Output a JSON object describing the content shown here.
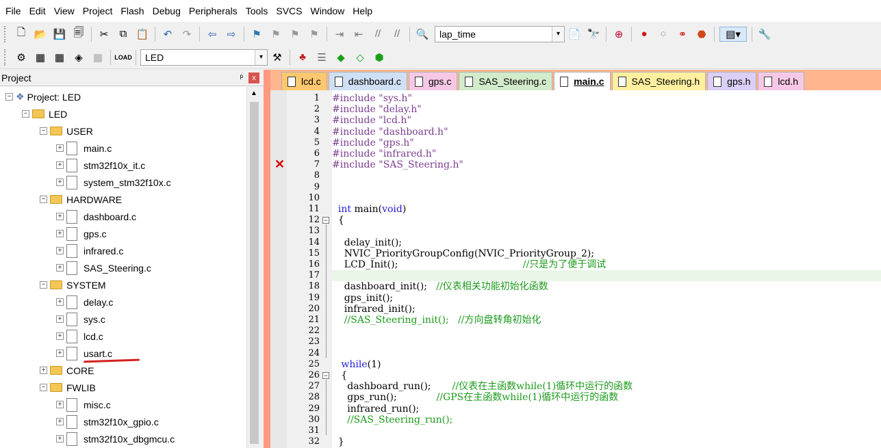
{
  "menu": [
    "File",
    "Edit",
    "View",
    "Project",
    "Flash",
    "Debug",
    "Peripherals",
    "Tools",
    "SVCS",
    "Window",
    "Help"
  ],
  "toolbar1": {
    "target_combo": "lap_time"
  },
  "toolbar2": {
    "target_select": "LED"
  },
  "project_panel": {
    "title": "Project",
    "pin": "ᵖ",
    "close": "x",
    "tree": [
      {
        "label": "Project: LED",
        "level": 0,
        "kind": "project",
        "exp": "−"
      },
      {
        "label": "LED",
        "level": 1,
        "kind": "group",
        "exp": "−"
      },
      {
        "label": "USER",
        "level": 2,
        "kind": "folder",
        "exp": "−"
      },
      {
        "label": "main.c",
        "level": 3,
        "kind": "file",
        "exp": "+"
      },
      {
        "label": "stm32f10x_it.c",
        "level": 3,
        "kind": "file",
        "exp": "+"
      },
      {
        "label": "system_stm32f10x.c",
        "level": 3,
        "kind": "file",
        "exp": "+"
      },
      {
        "label": "HARDWARE",
        "level": 2,
        "kind": "folder",
        "exp": "−"
      },
      {
        "label": "dashboard.c",
        "level": 3,
        "kind": "file",
        "exp": "+"
      },
      {
        "label": "gps.c",
        "level": 3,
        "kind": "file",
        "exp": "+"
      },
      {
        "label": "infrared.c",
        "level": 3,
        "kind": "file",
        "exp": "+"
      },
      {
        "label": "SAS_Steering.c",
        "level": 3,
        "kind": "file",
        "exp": "+"
      },
      {
        "label": "SYSTEM",
        "level": 2,
        "kind": "folder",
        "exp": "−"
      },
      {
        "label": "delay.c",
        "level": 3,
        "kind": "file",
        "exp": "+"
      },
      {
        "label": "sys.c",
        "level": 3,
        "kind": "file",
        "exp": "+"
      },
      {
        "label": "lcd.c",
        "level": 3,
        "kind": "file",
        "exp": "+"
      },
      {
        "label": "usart.c",
        "level": 3,
        "kind": "file",
        "exp": "+"
      },
      {
        "label": "CORE",
        "level": 2,
        "kind": "folder",
        "exp": "+"
      },
      {
        "label": "FWLIB",
        "level": 2,
        "kind": "folder",
        "exp": "−"
      },
      {
        "label": "misc.c",
        "level": 3,
        "kind": "file",
        "exp": "+"
      },
      {
        "label": "stm32f10x_gpio.c",
        "level": 3,
        "kind": "file",
        "exp": "+"
      },
      {
        "label": "stm32f10x_dbgmcu.c",
        "level": 3,
        "kind": "file",
        "exp": "+"
      }
    ]
  },
  "tabs": [
    {
      "label": "lcd.c",
      "color": "#ffc76f",
      "active": false
    },
    {
      "label": "dashboard.c",
      "color": "#cfe0f5",
      "active": false
    },
    {
      "label": "gps.c",
      "color": "#f7c8e6",
      "active": false
    },
    {
      "label": "SAS_Steering.c",
      "color": "#d2ebcb",
      "active": false
    },
    {
      "label": "main.c",
      "color": "#ffffff",
      "active": true
    },
    {
      "label": "SAS_Steering.h",
      "color": "#fff0a0",
      "active": false
    },
    {
      "label": "gps.h",
      "color": "#dccff5",
      "active": false
    },
    {
      "label": "lcd.h",
      "color": "#f7c8e6",
      "active": false
    }
  ],
  "editor": {
    "error_line": 7,
    "current_line": 17,
    "lines": [
      {
        "n": 1,
        "parts": [
          [
            "pp",
            "#include "
          ],
          [
            "str",
            "\"sys.h\""
          ]
        ]
      },
      {
        "n": 2,
        "parts": [
          [
            "pp",
            "#include "
          ],
          [
            "str",
            "\"delay.h\""
          ]
        ]
      },
      {
        "n": 3,
        "parts": [
          [
            "pp",
            "#include "
          ],
          [
            "str",
            "\"lcd.h\""
          ]
        ]
      },
      {
        "n": 4,
        "parts": [
          [
            "pp",
            "#include "
          ],
          [
            "str",
            "\"dashboard.h\""
          ]
        ]
      },
      {
        "n": 5,
        "parts": [
          [
            "pp",
            "#include "
          ],
          [
            "str",
            "\"gps.h\""
          ]
        ]
      },
      {
        "n": 6,
        "parts": [
          [
            "pp",
            "#include "
          ],
          [
            "str",
            "\"infrared.h\""
          ]
        ]
      },
      {
        "n": 7,
        "parts": [
          [
            "pp",
            "#include "
          ],
          [
            "str",
            "\"SAS_Steering.h\""
          ]
        ]
      },
      {
        "n": 8,
        "parts": []
      },
      {
        "n": 9,
        "parts": []
      },
      {
        "n": 10,
        "parts": []
      },
      {
        "n": 11,
        "parts": [
          [
            "",
            "  "
          ],
          [
            "kw",
            "int"
          ],
          [
            "",
            " main("
          ],
          [
            "kw",
            "void"
          ],
          [
            "",
            ")"
          ]
        ]
      },
      {
        "n": 12,
        "parts": [
          [
            "",
            "  {"
          ]
        ],
        "fold": "−"
      },
      {
        "n": 13,
        "parts": []
      },
      {
        "n": 14,
        "parts": [
          [
            "",
            "    delay_init();"
          ]
        ]
      },
      {
        "n": 15,
        "parts": [
          [
            "",
            "    NVIC_PriorityGroupConfig(NVIC_PriorityGroup_2);"
          ]
        ]
      },
      {
        "n": 16,
        "parts": [
          [
            "",
            "    LCD_Init();                                         "
          ],
          [
            "cm",
            "//只是为了便于调试"
          ]
        ]
      },
      {
        "n": 17,
        "parts": [
          [
            "",
            "    "
          ]
        ]
      },
      {
        "n": 18,
        "parts": [
          [
            "",
            "    dashboard_init();   "
          ],
          [
            "cm",
            "//仪表相关功能初始化函数"
          ]
        ]
      },
      {
        "n": 19,
        "parts": [
          [
            "",
            "    gps_init();"
          ]
        ]
      },
      {
        "n": 20,
        "parts": [
          [
            "",
            "    infrared_init();"
          ]
        ]
      },
      {
        "n": 21,
        "parts": [
          [
            "cm",
            "    //SAS_Steering_init();   //方向盘转角初始化"
          ]
        ]
      },
      {
        "n": 22,
        "parts": []
      },
      {
        "n": 23,
        "parts": []
      },
      {
        "n": 24,
        "parts": []
      },
      {
        "n": 25,
        "parts": [
          [
            "",
            "   "
          ],
          [
            "kw",
            "while"
          ],
          [
            "",
            "(1)"
          ]
        ]
      },
      {
        "n": 26,
        "parts": [
          [
            "",
            "   {"
          ]
        ],
        "fold": "−"
      },
      {
        "n": 27,
        "parts": [
          [
            "",
            "     dashboard_run();       "
          ],
          [
            "cm",
            "//仪表在主函数while(1)循环中运行的函数"
          ]
        ]
      },
      {
        "n": 28,
        "parts": [
          [
            "",
            "     gps_run();             "
          ],
          [
            "cm",
            "//GPS在主函数while(1)循环中运行的函数"
          ]
        ]
      },
      {
        "n": 29,
        "parts": [
          [
            "",
            "     infrared_run();"
          ]
        ]
      },
      {
        "n": 30,
        "parts": [
          [
            "cm",
            "     //SAS_Steering_run();"
          ]
        ]
      },
      {
        "n": 31,
        "parts": []
      },
      {
        "n": 32,
        "parts": [
          [
            "",
            "  }"
          ]
        ]
      }
    ]
  }
}
